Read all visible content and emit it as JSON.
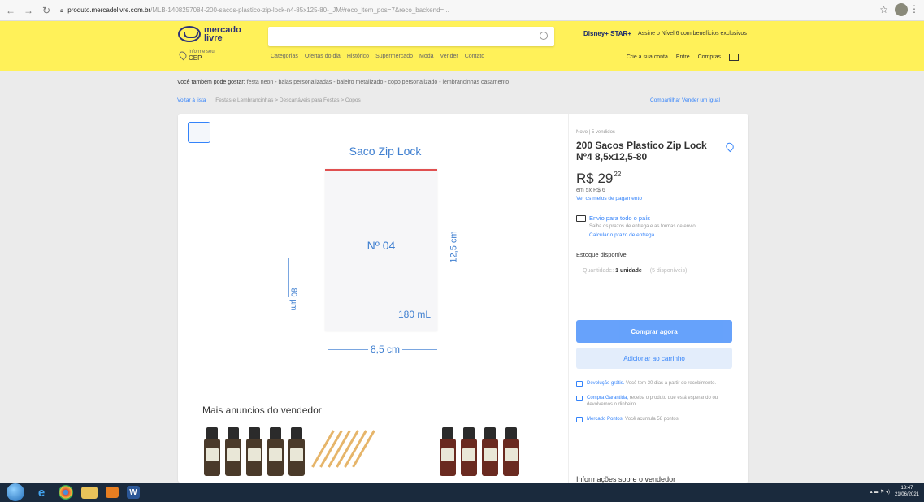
{
  "browser": {
    "url_host": "produto.mercadolivre.com.br",
    "url_path": "/MLB-1408257084-200-sacos-plastico-zip-lock-n4-85x125-80-_JM#reco_item_pos=7&reco_backend=..."
  },
  "header": {
    "logo_line1": "mercado",
    "logo_line2": "livre",
    "promo_brand": "Disney+ STAR+",
    "promo_text": "Assine o Nível 6 com benefícios exclusivos",
    "cep_small": "Informe seu",
    "cep_label": "CEP",
    "nav": [
      "Categorias",
      "Ofertas do dia",
      "Histórico",
      "Supermercado",
      "Moda",
      "Vender",
      "Contato"
    ],
    "user_links": [
      "Crie a sua conta",
      "Entre",
      "Compras"
    ]
  },
  "also_like": {
    "prefix": "Você também pode gostar:",
    "items": "festa neon - balas personalizadas - baleiro metalizado - copo personalizado - lembrancinhas casamento"
  },
  "breadcrumb": {
    "back": "Voltar à lista",
    "path": "Festas e Lembrancinhas > Descartáveis para Festas > Copos"
  },
  "top_actions": "Compartilhar   Vender um igual",
  "gallery": {
    "bag_title": "Saco Zip Lock",
    "bag_number": "Nº 04",
    "height": "12,5 cm",
    "width": "8,5 cm",
    "thickness": "80 µm",
    "volume": "180 mL"
  },
  "more_seller": {
    "title": "Mais anuncios do vendedor"
  },
  "product": {
    "condition": "Novo  |  5 vendidos",
    "title": "200 Sacos Plastico Zip Lock Nº4 8,5x12,5-80",
    "price_main": "R$ 29",
    "price_cents": "22",
    "installments": "em 5x R$ 6",
    "payment_link": "Ver os meios de pagamento",
    "shipping_title": "Envio para todo o país",
    "shipping_sub": "Saiba os prazos de entrega e as formas de envio.",
    "shipping_link": "Calcular o prazo de entrega",
    "stock": "Estoque disponível",
    "qty_label": "Quantidade:",
    "qty_value": "1 unidade",
    "qty_available": "(5 disponíveis)",
    "buy_label": "Comprar agora",
    "cart_label": "Adicionar ao carrinho",
    "guarantees": [
      {
        "link": "Devolução grátis.",
        "text": "Você tem 30 dias a partir do recebimento."
      },
      {
        "link": "Compra Garantida,",
        "text": "receba o produto que está esperando ou devolvemos o dinheiro."
      },
      {
        "link": "Mercado Pontos.",
        "text": "Você acumula 58 pontos."
      }
    ],
    "seller_info": "Informações sobre o vendedor"
  },
  "taskbar": {
    "time": "13:47",
    "date": "21/06/2021"
  }
}
